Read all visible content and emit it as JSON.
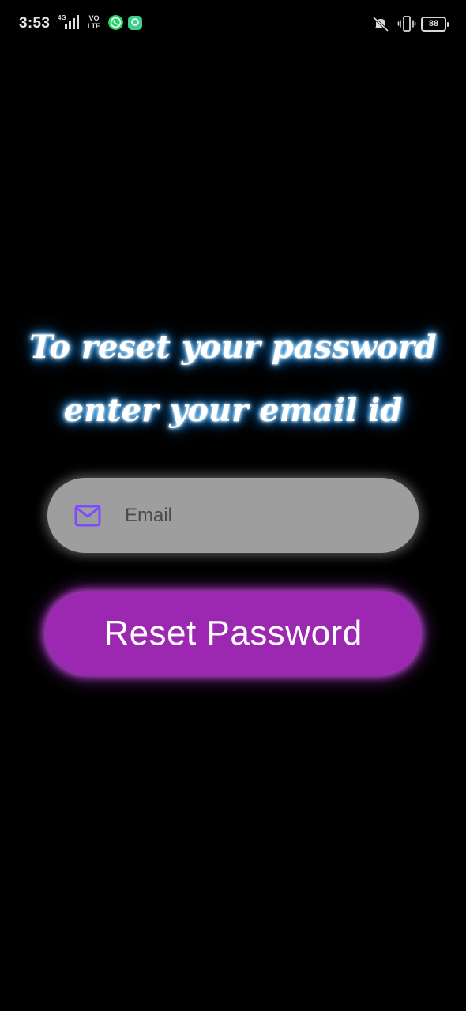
{
  "status_bar": {
    "time": "3:53",
    "network": "4G",
    "volte_top": "VO",
    "volte_bottom": "LTE",
    "battery": "88"
  },
  "heading": {
    "line1": "To reset your password",
    "line2": "enter your email id"
  },
  "email_field": {
    "placeholder": "Email",
    "value": "",
    "icon": "mail-icon"
  },
  "reset_button": {
    "label": "Reset Password"
  },
  "colors": {
    "background": "#000000",
    "heading_glow": "#2aa3ff",
    "field_background": "#9e9e9e",
    "mail_icon": "#7c4dff",
    "button_background": "#9c27b0",
    "button_glow": "#d650f0"
  }
}
